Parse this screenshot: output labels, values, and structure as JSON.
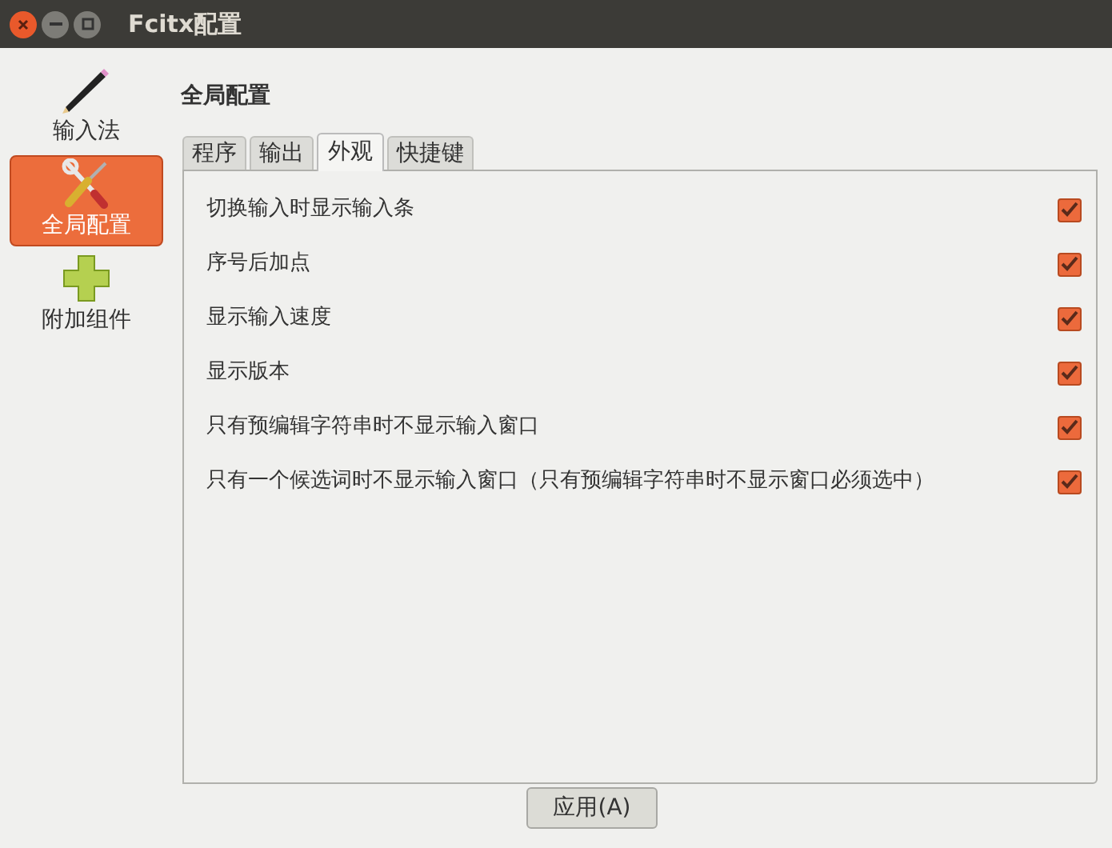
{
  "window": {
    "title": "Fcitx配置"
  },
  "sidebar": {
    "items": [
      {
        "label": "输入法",
        "kind": "pencil",
        "selected": false
      },
      {
        "label": "全局配置",
        "kind": "tools",
        "selected": true
      },
      {
        "label": "附加组件",
        "kind": "plus",
        "selected": false
      }
    ]
  },
  "heading": "全局配置",
  "tabs": [
    {
      "label": "程序",
      "selected": false
    },
    {
      "label": "输出",
      "selected": false
    },
    {
      "label": "外观",
      "selected": true
    },
    {
      "label": "快捷键",
      "selected": false
    }
  ],
  "options": [
    {
      "label": "切换输入时显示输入条",
      "checked": true
    },
    {
      "label": "序号后加点",
      "checked": true
    },
    {
      "label": "显示输入速度",
      "checked": true
    },
    {
      "label": "显示版本",
      "checked": true
    },
    {
      "label": "只有预编辑字符串时不显示输入窗口",
      "checked": true
    },
    {
      "label": "只有一个候选词时不显示输入窗口（只有预编辑字符串时不显示窗口必须选中）",
      "checked": true
    }
  ],
  "apply_button": "应用(A)"
}
